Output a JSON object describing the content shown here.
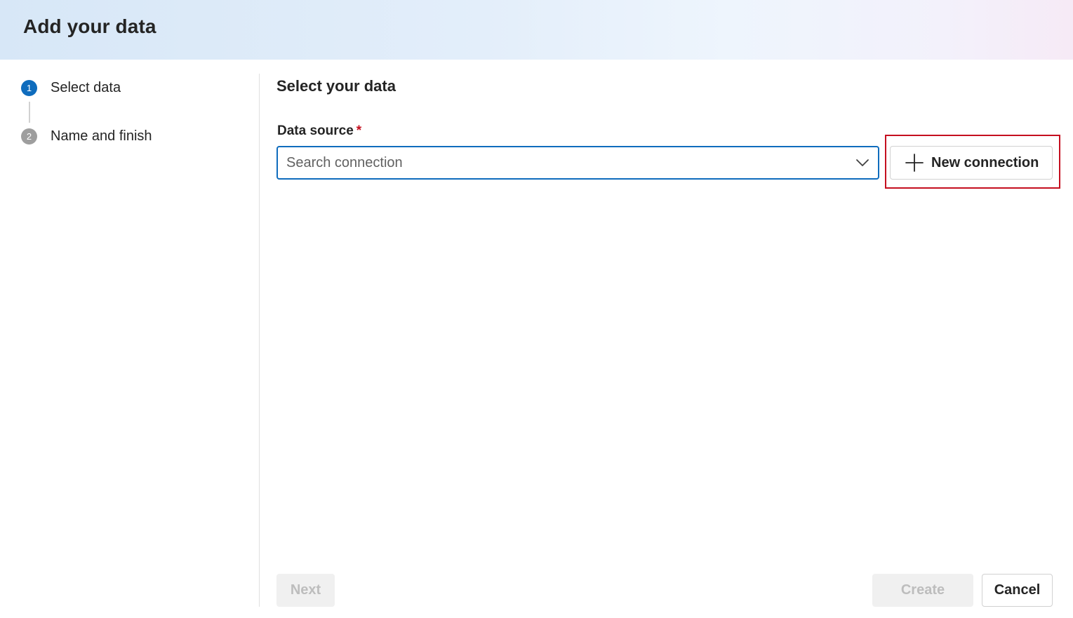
{
  "dialog": {
    "title": "Add your data"
  },
  "steps": [
    {
      "number": "1",
      "label": "Select data",
      "state": "active"
    },
    {
      "number": "2",
      "label": "Name and finish",
      "state": "inactive"
    }
  ],
  "main": {
    "section_title": "Select your data",
    "data_source": {
      "label": "Data source",
      "required_marker": "*",
      "placeholder": "Search connection",
      "value": ""
    },
    "new_connection": {
      "label": "New connection",
      "icon": "plus-icon"
    }
  },
  "footer": {
    "next_label": "Next",
    "create_label": "Create",
    "cancel_label": "Cancel"
  },
  "colors": {
    "accent": "#0f6cbd",
    "highlight_border": "#c50f1f",
    "required": "#c50f1f",
    "disabled_bg": "#f0f0f0",
    "disabled_text": "#bdbdbd"
  }
}
